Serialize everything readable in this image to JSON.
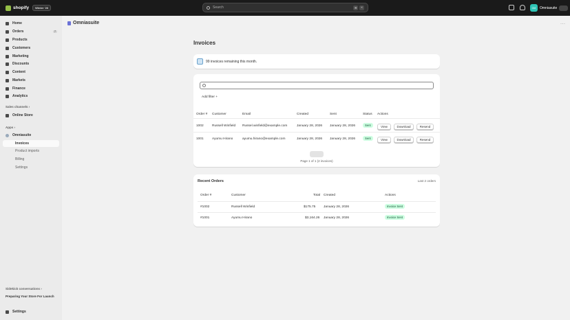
{
  "topbar": {
    "brand": "shopify",
    "badge": "Winter '26",
    "search_placeholder": "Search",
    "shortcut_keys": [
      "⌘",
      "K"
    ],
    "store_name": "Omniasuite",
    "store_initials": "OM"
  },
  "sidebar": {
    "nav": [
      {
        "label": "Home",
        "icon": "home-icon"
      },
      {
        "label": "Orders",
        "icon": "orders-icon",
        "badge": "7"
      },
      {
        "label": "Products",
        "icon": "tag-icon"
      },
      {
        "label": "Customers",
        "icon": "person-icon"
      },
      {
        "label": "Marketing",
        "icon": "target-icon"
      },
      {
        "label": "Discounts",
        "icon": "discount-icon"
      },
      {
        "label": "Content",
        "icon": "content-icon"
      },
      {
        "label": "Markets",
        "icon": "globe-icon"
      },
      {
        "label": "Finance",
        "icon": "bank-icon"
      },
      {
        "label": "Analytics",
        "icon": "chart-icon"
      }
    ],
    "sales_channels_label": "Sales channels",
    "online_store": "Online Store",
    "apps_label": "Apps",
    "app_name": "Omniasuite",
    "app_subitems": [
      "Invoices",
      "Product imports",
      "Billing",
      "Settings"
    ],
    "sidekick_label": "Sidekick conversations",
    "sidekick_item": "Preparing Your Store For Launch",
    "settings": "Settings"
  },
  "header": {
    "app_title": "Omniasuite",
    "more": "···"
  },
  "page": {
    "title": "Invoices",
    "banner_text": "99 invoices remaining this month."
  },
  "invoices": {
    "add_filter": "Add filter +",
    "columns": [
      "Order #",
      "Customer",
      "Email",
      "Created",
      "Sent",
      "Status",
      "Actions"
    ],
    "rows": [
      {
        "order": "1002",
        "customer": "Russell Winfield",
        "email": "Russel.winfield@example.com",
        "created": "January 28, 2026",
        "sent": "January 28, 2026",
        "status": "Sent"
      },
      {
        "order": "1001",
        "customer": "Ayumu Hirano",
        "email": "ayumu.hirano@example.com",
        "created": "January 28, 2026",
        "sent": "January 28, 2026",
        "status": "Sent"
      }
    ],
    "actions": {
      "view": "View",
      "download": "Download",
      "resend": "Resend"
    },
    "page_info": "Page 1 of 1 (2 invoices)"
  },
  "recent_orders": {
    "title": "Recent Orders",
    "count": "Last 2 orders",
    "columns": [
      "Order #",
      "Customer",
      "Total",
      "Created",
      "Actions"
    ],
    "rows": [
      {
        "order": "#1002",
        "customer": "Russell Winfield",
        "total": "$175.75",
        "created": "January 28, 2026",
        "action": "Invoice Sent"
      },
      {
        "order": "#1001",
        "customer": "Ayumu Hirano",
        "total": "$3,164.26",
        "created": "January 28, 2026",
        "action": "Invoice Sent"
      }
    ]
  },
  "colors": {
    "topbar": "#1a1a1a",
    "sidebar": "#ebebeb",
    "background": "#f1f1f1",
    "success_bg": "#cdfee1",
    "success_text": "#0c5132"
  }
}
